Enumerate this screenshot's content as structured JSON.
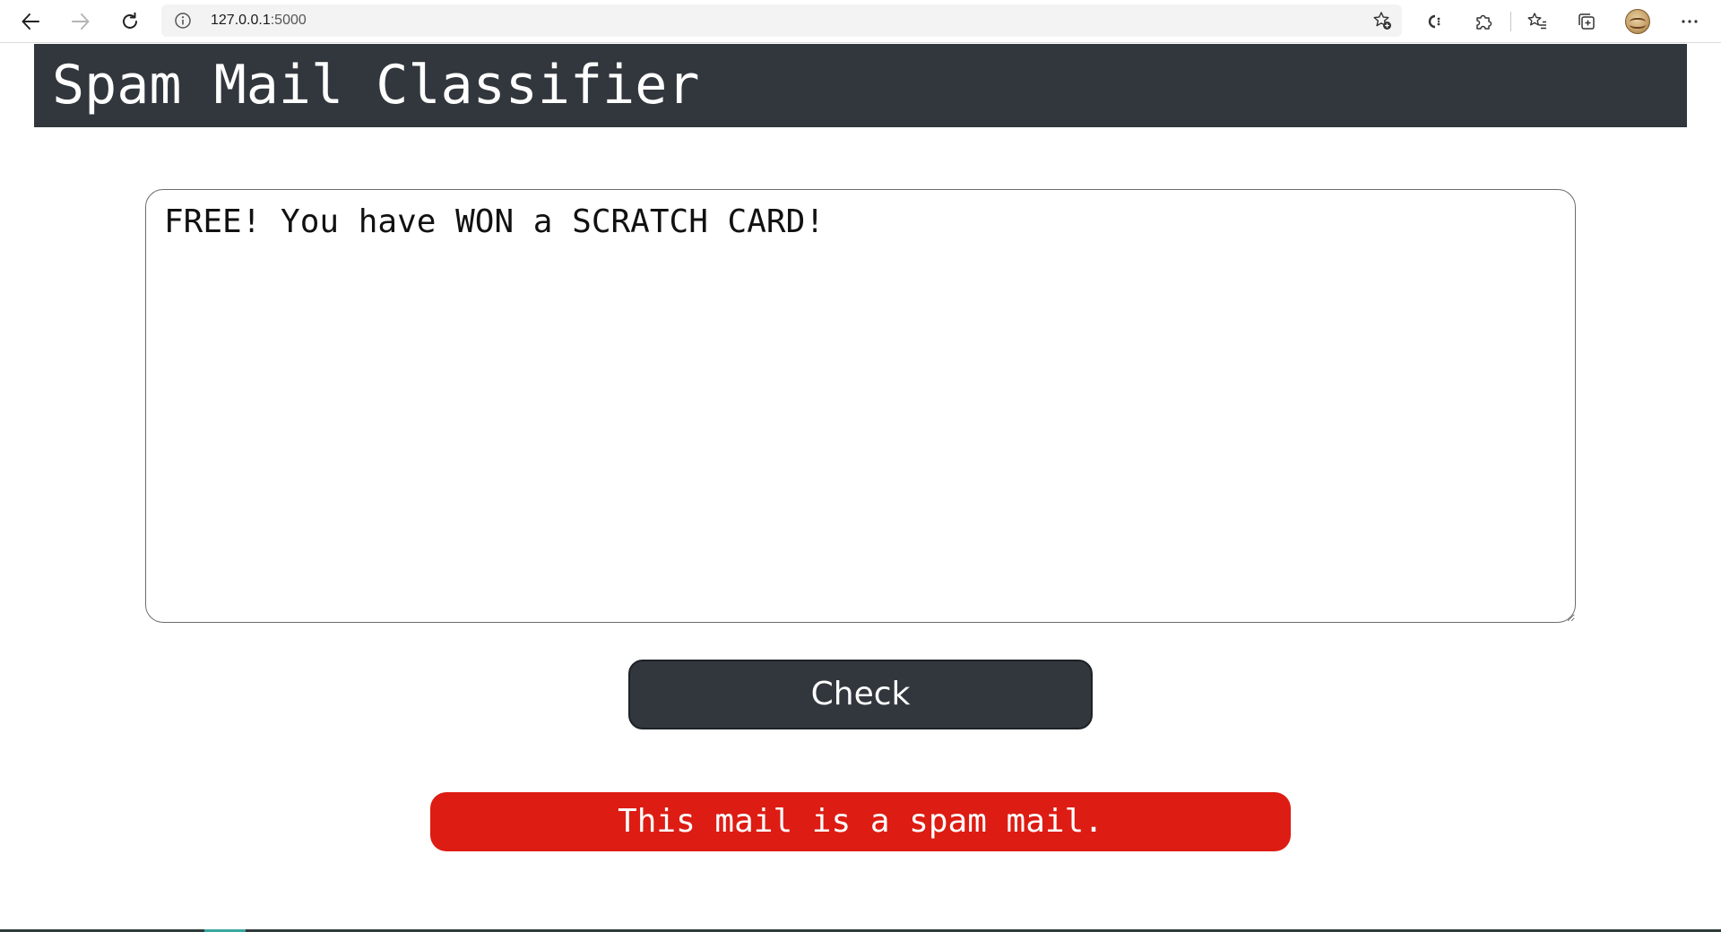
{
  "browser": {
    "address": {
      "host": "127.0.0.1",
      "port": ":5000"
    },
    "icons": {
      "back": "back-arrow-icon",
      "forward": "forward-arrow-icon",
      "refresh": "refresh-icon",
      "info": "info-icon",
      "favorite_add": "star-add-icon",
      "reading": "read-aloud-icon",
      "extensions": "puzzle-icon",
      "favorites": "favorites-list-icon",
      "collections": "collections-icon",
      "profile": "avatar",
      "more": "more-dots-icon"
    }
  },
  "header": {
    "title": "Spam Mail Classifier",
    "background_color": "#32373d"
  },
  "form": {
    "mail_text": "FREE! You have WON a SCRATCH CARD!",
    "check_label": "Check"
  },
  "result": {
    "message": "This mail is a spam mail.",
    "color": "#dd1c13"
  }
}
